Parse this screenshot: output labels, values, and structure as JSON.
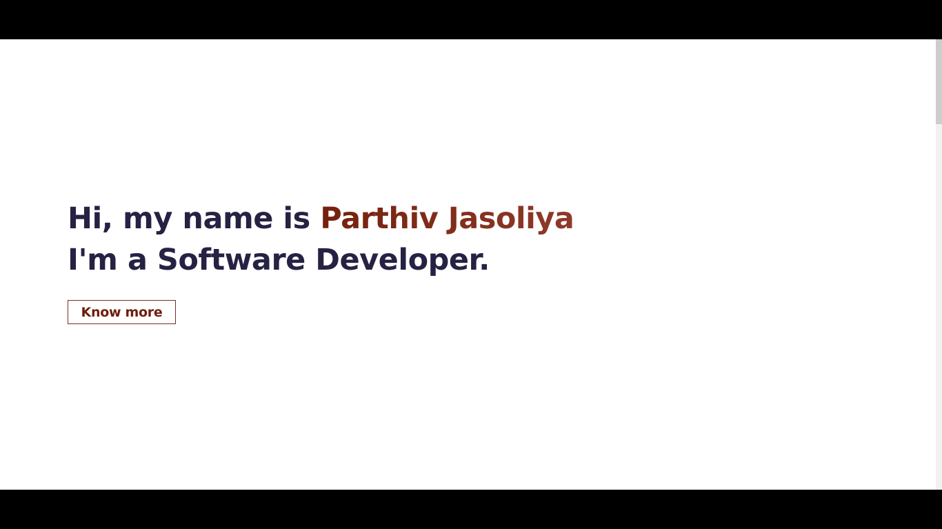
{
  "hero": {
    "greeting": "Hi, my name is ",
    "name": "Parthiv Jasoliya",
    "tagline": "I'm a Software Developer.",
    "button_label": "Know more"
  },
  "colors": {
    "heading": "#262244",
    "accent": "#75200c"
  }
}
